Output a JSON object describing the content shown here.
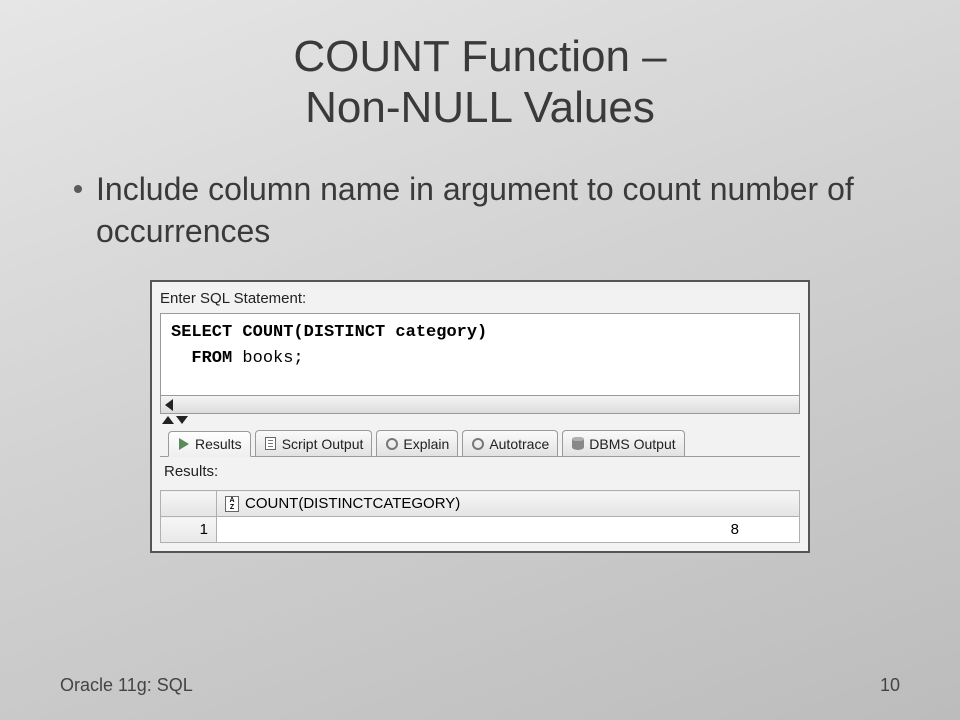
{
  "title_line1": "COUNT Function –",
  "title_line2": "Non-NULL Values",
  "bullet": "Include column name in argument to count number of occurrences",
  "sql_panel": {
    "prompt": "Enter SQL Statement:",
    "line1_pre": "SELECT COUNT(DISTINCT category)",
    "line2_kw": "FROM",
    "line2_rest": " books;"
  },
  "tabs": {
    "results": "Results",
    "script_output": "Script Output",
    "explain": "Explain",
    "autotrace": "Autotrace",
    "dbms_output": "DBMS Output"
  },
  "results": {
    "label": "Results:",
    "col_header": "COUNT(DISTINCTCATEGORY)",
    "row_number": "1",
    "value": "8"
  },
  "footer_left": "Oracle 11g: SQL",
  "footer_right": "10",
  "chart_data": {
    "type": "table",
    "title": "COUNT(DISTINCTCATEGORY)",
    "columns": [
      "COUNT(DISTINCTCATEGORY)"
    ],
    "rows": [
      [
        8
      ]
    ]
  }
}
